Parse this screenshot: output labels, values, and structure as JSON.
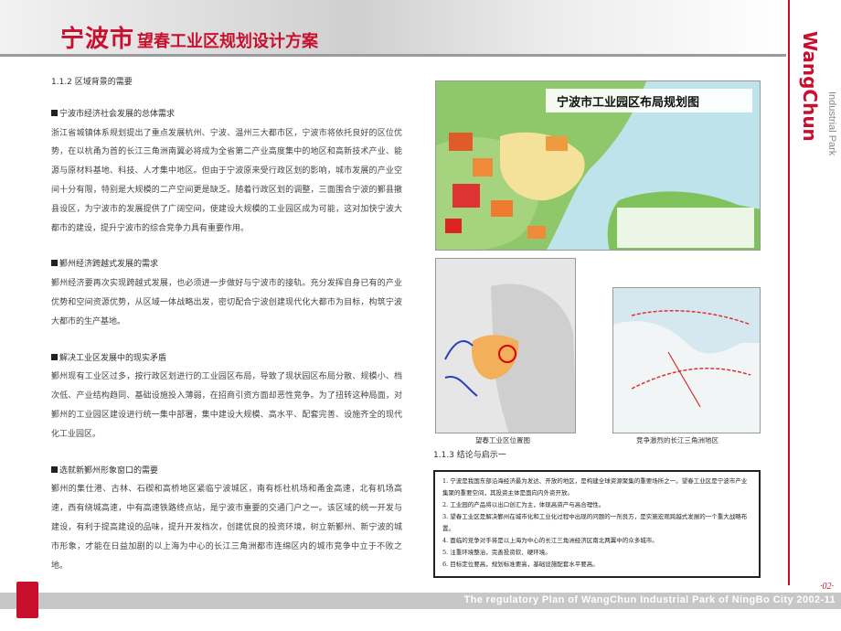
{
  "header": {
    "logo_chars": "宁波市",
    "title": "望春工业区规划设计方案"
  },
  "brand": {
    "vertical_name": "WangChun",
    "vertical_sub": "Industrial Park",
    "page_number": "·02·"
  },
  "footer": {
    "text": "The regulatory Plan of WangChun Industrial Park of NingBo City   2002-11"
  },
  "section": {
    "heading": "1.1.2   区域背景的需要",
    "blocks": [
      {
        "title": "宁波市经济社会发展的总体需求",
        "body": "浙江省城镇体系规划提出了重点发展杭州、宁波、温州三大都市区，宁波市将依托良好的区位优势，在以杭甬为首的长江三角洲南翼必将成为全省第二产业高度集中的地区和高新技术产业、能源与原材料基地、科技、人才集中地区。但由于宁波原来受行政区划的影响，城市发展的产业空间十分有限，特别是大规模的二产空间更是缺乏。随着行政区划的调整，三面围合宁波的鄞县撤县设区，为宁波市的发展提供了广阔空间，使建设大规模的工业园区成为可能，这对加快宁波大都市的建设，提升宁波市的综合竞争力具有重要作用。"
      },
      {
        "title": "鄞州经济跨越式发展的需求",
        "body": "鄞州经济要再次实现跨越式发展，也必须进一步做好与宁波市的接轨。充分发挥自身已有的产业优势和空间资源优势，从区域一体战略出发，密切配合宁波创建现代化大都市为目标，构筑宁波大都市的生产基地。"
      },
      {
        "title": "解决工业区发展中的现实矛盾",
        "body": "鄞州现有工业区过多，按行政区划进行的工业园区布局，导致了现状园区布局分散、规模小、档次低、产业结构趋同、基础设施投入薄弱，在招商引资方面却恶性竞争。为了扭转这种局面，对鄞州的工业园区建设进行统一集中部署，集中建设大规模、高水平、配套完善、设施齐全的现代化工业园区。"
      },
      {
        "title": "选就新鄞州形象窗口的需要",
        "body": "鄞州的集仕港、古林、石碶和高桥地区紧临宁波城区，南有栎社机场和甬金高速，北有机场高速，西有绕城高速，中有高速铁路终点站，是宁波市重要的交通门户之一。该区域的统一开发与建设，有利于提高建设的品味，提升开发档次，创建优良的投资环境，树立新鄞州、新宁波的城市形象，才能在日益加剧的以上海为中心的长江三角洲都市连绵区内的城市竞争中立于不败之地。"
      }
    ]
  },
  "maps": {
    "main_title": "宁波市工业园区布局规划图",
    "location_caption": "望春工业区位置图",
    "region_caption": "竞争激烈的长江三角洲地区"
  },
  "conclusion": {
    "heading": "1.1.3   结论与启示一",
    "items": [
      "1. 宁波是我国东部沿海经济最为发达、开放的地区，是构建全球资源聚集的重要场所之一。望春工业区是宁波市产业集聚的重要空间，其投资主体是面向内外资开放。",
      "2. 工业园的产品将以出口创汇为主，体现高资产与高合理性。",
      "3. 望春工业区是解决鄞州在城市化和工业化过程中出现的问题的一剂良方，是实施宏观跨越式发展的一个重大战略布置。",
      "4. 面临的竞争对手将是以上海为中心的长江三角洲经济区南北两翼中的众多城市。",
      "5. 注重环境整治，完善投资软、硬环境。",
      "6. 目标定位要高，规划标准要高，基础设施配套水平要高。"
    ]
  },
  "colors": {
    "accent": "#c8102e",
    "footer_bar": "#c7c7c7"
  }
}
